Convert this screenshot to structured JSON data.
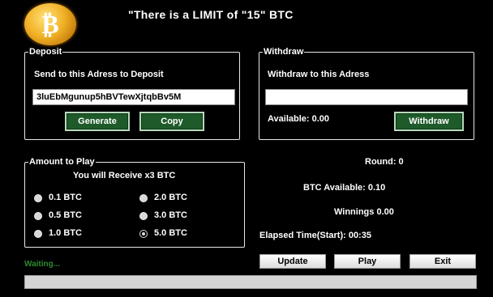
{
  "header": {
    "logo_glyph": "₿",
    "headline": "\"There is a LIMIT of \"15\" BTC"
  },
  "deposit": {
    "legend": "Deposit",
    "instruction": "Send to this Adress to Deposit",
    "address_value": "3luEbMgunup5hBVTewXjtqbBv5M",
    "generate_label": "Generate",
    "copy_label": "Copy"
  },
  "withdraw": {
    "legend": "Withdraw",
    "instruction": "Withdraw to this Adress",
    "address_value": "",
    "available_text": "Available: 0.00",
    "withdraw_label": "Withdraw"
  },
  "amount": {
    "legend": "Amount to Play",
    "receive_text": "You will Receive x3 BTC",
    "options": [
      "0.1 BTC",
      "0.5 BTC",
      "1.0 BTC",
      "2.0 BTC",
      "3.0 BTC",
      "5.0 BTC"
    ],
    "selected": "5.0 BTC"
  },
  "stats": {
    "round": "Round: 0",
    "btc_available": "BTC Available: 0.10",
    "winnings": "Winnings 0.00",
    "elapsed": "Elapsed Time(Start): 00:35"
  },
  "actions": {
    "update_label": "Update",
    "play_label": "Play",
    "exit_label": "Exit"
  },
  "status_text": "Waiting...",
  "progress_fraction": 0.0,
  "colors": {
    "background": "#000000",
    "green_button": "#1f5a2a",
    "status_green": "#2e8a2e",
    "coin_gold": "#f2b227"
  }
}
